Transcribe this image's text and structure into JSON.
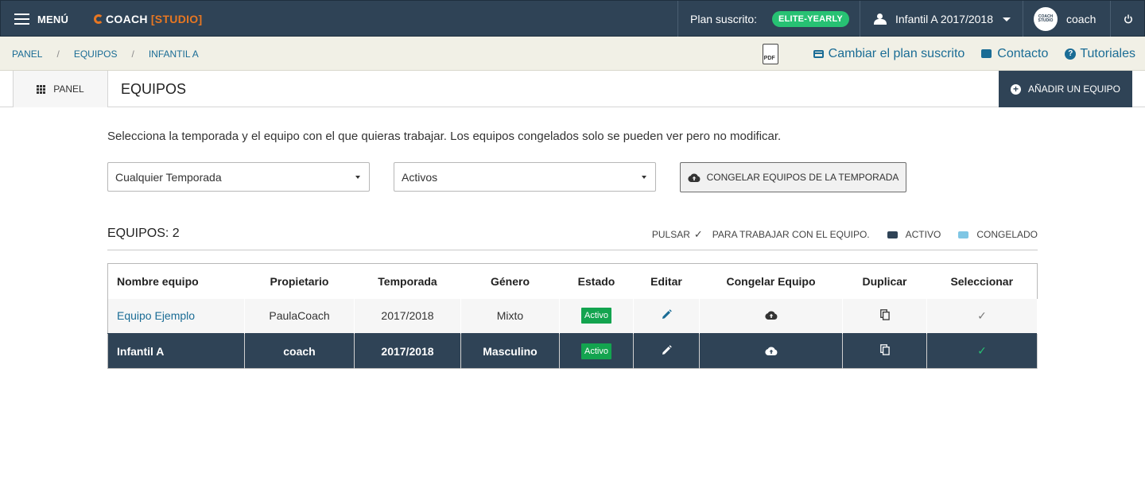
{
  "topbar": {
    "menu_label": "MENÚ",
    "logo_text": "COACH",
    "logo_studio": "[STUDIO]",
    "plan_label": "Plan suscrito:",
    "plan_badge": "ELITE-YEARLY",
    "team_selector": "Infantil A 2017/2018",
    "avatar_text": "COACH STUDIO",
    "username": "coach"
  },
  "breadcrumb": {
    "items": [
      "PANEL",
      "EQUIPOS",
      "INFANTIL A"
    ],
    "pdf_label": "PDF",
    "links": [
      "Cambiar el plan suscrito",
      "Contacto",
      "Tutoriales"
    ]
  },
  "header": {
    "panel_button": "PANEL",
    "title": "EQUIPOS",
    "add_button": "AÑADIR UN EQUIPO"
  },
  "main": {
    "intro": "Selecciona la temporada y el equipo con el que quieras trabajar. Los equipos congelados solo se pueden ver pero no modificar.",
    "season_select": "Cualquier Temporada",
    "status_select": "Activos",
    "freeze_button": "CONGELAR EQUIPOS DE LA TEMPORADA",
    "count_label": "EQUIPOS: 2",
    "legend": {
      "press": "PULSAR",
      "press_after": "PARA TRABAJAR CON EL EQUIPO.",
      "active": "ACTIVO",
      "frozen": "CONGELADO"
    }
  },
  "table": {
    "columns": [
      "Nombre equipo",
      "Propietario",
      "Temporada",
      "Género",
      "Estado",
      "Editar",
      "Congelar Equipo",
      "Duplicar",
      "Seleccionar"
    ],
    "rows": [
      {
        "name": "Equipo Ejemplo",
        "owner": "PaulaCoach",
        "season": "2017/2018",
        "gender": "Mixto",
        "status": "Activo"
      },
      {
        "name": "Infantil A",
        "owner": "coach",
        "season": "2017/2018",
        "gender": "Masculino",
        "status": "Activo"
      }
    ]
  },
  "colors": {
    "navy": "#2f4356",
    "link": "#1a6c95",
    "active_green": "#13a44f",
    "brand_orange": "#e87722"
  }
}
